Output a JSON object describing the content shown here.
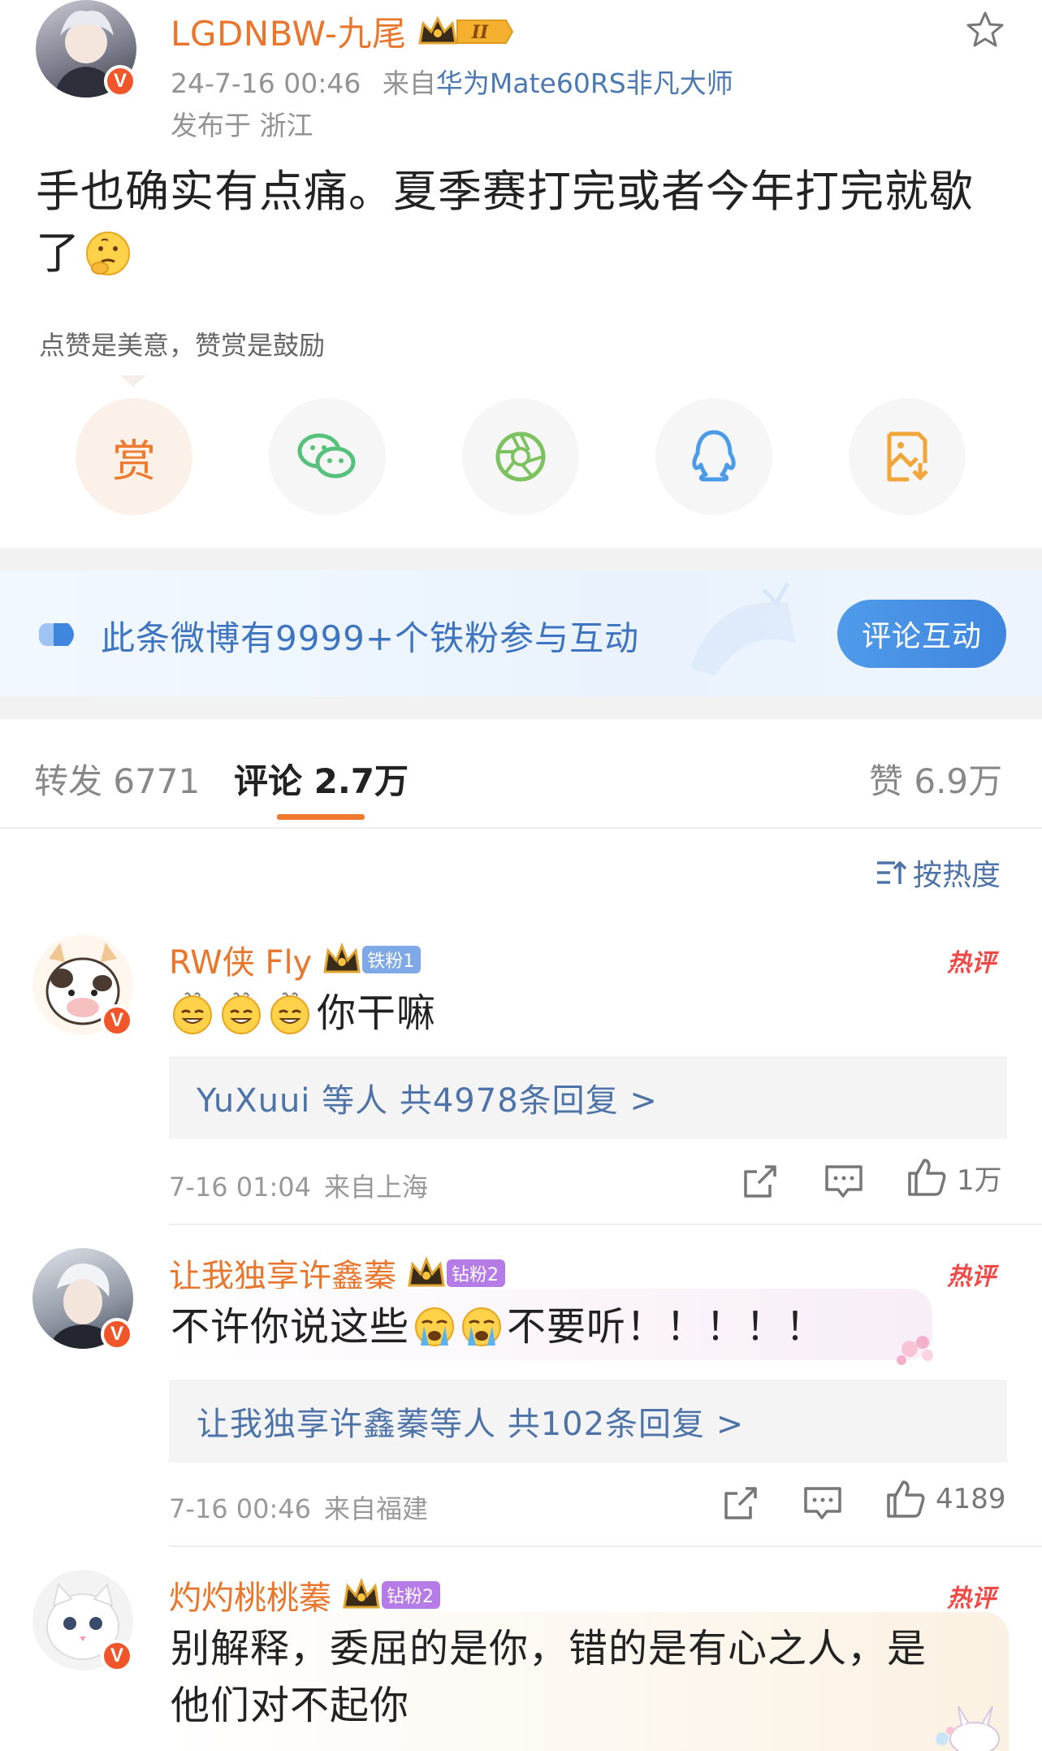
{
  "post": {
    "author": "LGDNBW-九尾",
    "level_badge": "II",
    "time": "24-7-16 00:46",
    "source_prefix": "来自",
    "source": "华为Mate60RS非凡大师",
    "location": "发布于 浙江",
    "text_line1": "手也确实有点痛。夏季赛打完或者今年打完就歇",
    "text_line2": "了"
  },
  "reward": {
    "tip": "点赞是美意，赞赏是鼓励",
    "reward_label": "赏",
    "share_icons": [
      "wechat-icon",
      "moments-icon",
      "qq-icon",
      "save-image-icon"
    ]
  },
  "banner": {
    "text": "此条微博有9999+个铁粉参与互动",
    "button": "评论互动"
  },
  "tabs": {
    "repost": "转发 6771",
    "comment": "评论 2.7万",
    "like": "赞 6.9万"
  },
  "sort": {
    "label": "按热度"
  },
  "comments": [
    {
      "name": "RW侠 Fly",
      "fan_badge": "铁粉1",
      "hot": "热评",
      "text": "你干嘛",
      "reply_summary": "YuXuui 等人  共4978条回复 >",
      "time": "7-16 01:04",
      "location": "来自上海",
      "likes": "1万"
    },
    {
      "name": "让我独享许鑫蓁",
      "fan_badge": "钻粉2",
      "hot": "热评",
      "text_pre": "不许你说这些",
      "text_post": "不要听！！！！！",
      "reply_summary": "让我独享许鑫蓁等人  共102条回复 >",
      "time": "7-16 00:46",
      "location": "来自福建",
      "likes": "4189"
    },
    {
      "name": "灼灼桃桃蓁",
      "fan_badge": "钻粉2",
      "hot": "热评",
      "text_line1": "别解释，委屈的是你，错的是有心之人，是",
      "text_line2": "他们对不起你"
    }
  ],
  "colors": {
    "accent_orange": "#e8762d",
    "link_blue": "#4d73a8",
    "hot_red": "#ee4b48",
    "banner_button": "#4f9ae9"
  }
}
